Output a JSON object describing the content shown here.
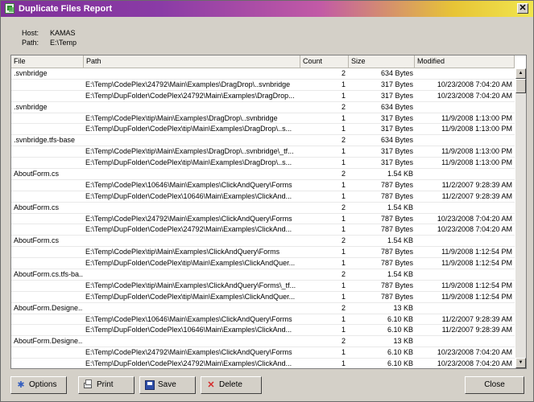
{
  "window": {
    "title": "Duplicate Files Report",
    "close_glyph": "✕"
  },
  "info": {
    "host_label": "Host:",
    "host_value": "KAMAS",
    "path_label": "Path:",
    "path_value": "E:\\Temp"
  },
  "columns": {
    "file": "File",
    "path": "Path",
    "count": "Count",
    "size": "Size",
    "modified": "Modified"
  },
  "rows": [
    {
      "file": ".svnbridge",
      "path": "",
      "count": "2",
      "size": "634 Bytes",
      "modified": ""
    },
    {
      "file": "",
      "path": "E:\\Temp\\CodePlex\\24792\\Main\\Examples\\DragDrop\\..svnbridge",
      "count": "1",
      "size": "317 Bytes",
      "modified": "10/23/2008 7:04:20 AM"
    },
    {
      "file": "",
      "path": "E:\\Temp\\DupFolder\\CodePlex\\24792\\Main\\Examples\\DragDrop...",
      "count": "1",
      "size": "317 Bytes",
      "modified": "10/23/2008 7:04:20 AM"
    },
    {
      "file": ".svnbridge",
      "path": "",
      "count": "2",
      "size": "634 Bytes",
      "modified": ""
    },
    {
      "file": "",
      "path": "E:\\Temp\\CodePlex\\tip\\Main\\Examples\\DragDrop\\..svnbridge",
      "count": "1",
      "size": "317 Bytes",
      "modified": "11/9/2008 1:13:00 PM"
    },
    {
      "file": "",
      "path": "E:\\Temp\\DupFolder\\CodePlex\\tip\\Main\\Examples\\DragDrop\\..s...",
      "count": "1",
      "size": "317 Bytes",
      "modified": "11/9/2008 1:13:00 PM"
    },
    {
      "file": ".svnbridge.tfs-base",
      "path": "",
      "count": "2",
      "size": "634 Bytes",
      "modified": ""
    },
    {
      "file": "",
      "path": "E:\\Temp\\CodePlex\\tip\\Main\\Examples\\DragDrop\\..svnbridge\\_tf...",
      "count": "1",
      "size": "317 Bytes",
      "modified": "11/9/2008 1:13:00 PM"
    },
    {
      "file": "",
      "path": "E:\\Temp\\DupFolder\\CodePlex\\tip\\Main\\Examples\\DragDrop\\..s...",
      "count": "1",
      "size": "317 Bytes",
      "modified": "11/9/2008 1:13:00 PM"
    },
    {
      "file": "AboutForm.cs",
      "path": "",
      "count": "2",
      "size": "1.54 KB",
      "modified": ""
    },
    {
      "file": "",
      "path": "E:\\Temp\\CodePlex\\10646\\Main\\Examples\\ClickAndQuery\\Forms",
      "count": "1",
      "size": "787 Bytes",
      "modified": "11/2/2007 9:28:39 AM"
    },
    {
      "file": "",
      "path": "E:\\Temp\\DupFolder\\CodePlex\\10646\\Main\\Examples\\ClickAnd...",
      "count": "1",
      "size": "787 Bytes",
      "modified": "11/2/2007 9:28:39 AM"
    },
    {
      "file": "AboutForm.cs",
      "path": "",
      "count": "2",
      "size": "1.54 KB",
      "modified": ""
    },
    {
      "file": "",
      "path": "E:\\Temp\\CodePlex\\24792\\Main\\Examples\\ClickAndQuery\\Forms",
      "count": "1",
      "size": "787 Bytes",
      "modified": "10/23/2008 7:04:20 AM"
    },
    {
      "file": "",
      "path": "E:\\Temp\\DupFolder\\CodePlex\\24792\\Main\\Examples\\ClickAnd...",
      "count": "1",
      "size": "787 Bytes",
      "modified": "10/23/2008 7:04:20 AM"
    },
    {
      "file": "AboutForm.cs",
      "path": "",
      "count": "2",
      "size": "1.54 KB",
      "modified": ""
    },
    {
      "file": "",
      "path": "E:\\Temp\\CodePlex\\tip\\Main\\Examples\\ClickAndQuery\\Forms",
      "count": "1",
      "size": "787 Bytes",
      "modified": "11/9/2008 1:12:54 PM"
    },
    {
      "file": "",
      "path": "E:\\Temp\\DupFolder\\CodePlex\\tip\\Main\\Examples\\ClickAndQuer...",
      "count": "1",
      "size": "787 Bytes",
      "modified": "11/9/2008 1:12:54 PM"
    },
    {
      "file": "AboutForm.cs.tfs-ba...",
      "path": "",
      "count": "2",
      "size": "1.54 KB",
      "modified": ""
    },
    {
      "file": "",
      "path": "E:\\Temp\\CodePlex\\tip\\Main\\Examples\\ClickAndQuery\\Forms\\_tf...",
      "count": "1",
      "size": "787 Bytes",
      "modified": "11/9/2008 1:12:54 PM"
    },
    {
      "file": "",
      "path": "E:\\Temp\\DupFolder\\CodePlex\\tip\\Main\\Examples\\ClickAndQuer...",
      "count": "1",
      "size": "787 Bytes",
      "modified": "11/9/2008 1:12:54 PM"
    },
    {
      "file": "AboutForm.Designe...",
      "path": "",
      "count": "2",
      "size": "13 KB",
      "modified": ""
    },
    {
      "file": "",
      "path": "E:\\Temp\\CodePlex\\10646\\Main\\Examples\\ClickAndQuery\\Forms",
      "count": "1",
      "size": "6.10 KB",
      "modified": "11/2/2007 9:28:39 AM"
    },
    {
      "file": "",
      "path": "E:\\Temp\\DupFolder\\CodePlex\\10646\\Main\\Examples\\ClickAnd...",
      "count": "1",
      "size": "6.10 KB",
      "modified": "11/2/2007 9:28:39 AM"
    },
    {
      "file": "AboutForm.Designe...",
      "path": "",
      "count": "2",
      "size": "13 KB",
      "modified": ""
    },
    {
      "file": "",
      "path": "E:\\Temp\\CodePlex\\24792\\Main\\Examples\\ClickAndQuery\\Forms",
      "count": "1",
      "size": "6.10 KB",
      "modified": "10/23/2008 7:04:20 AM"
    },
    {
      "file": "",
      "path": "E:\\Temp\\DupFolder\\CodePlex\\24792\\Main\\Examples\\ClickAnd...",
      "count": "1",
      "size": "6.10 KB",
      "modified": "10/23/2008 7:04:20 AM"
    }
  ],
  "scrollbar": {
    "up_glyph": "▲",
    "down_glyph": "▼"
  },
  "buttons": {
    "options": {
      "label": "Options",
      "icon": "options-icon",
      "glyph": "✱"
    },
    "print": {
      "label": "Print",
      "icon": "printer-icon"
    },
    "save": {
      "label": "Save",
      "icon": "floppy-disk-icon"
    },
    "delete": {
      "label": "Delete",
      "icon": "delete-x-icon",
      "glyph": "✕"
    },
    "close": {
      "label": "Close"
    }
  }
}
